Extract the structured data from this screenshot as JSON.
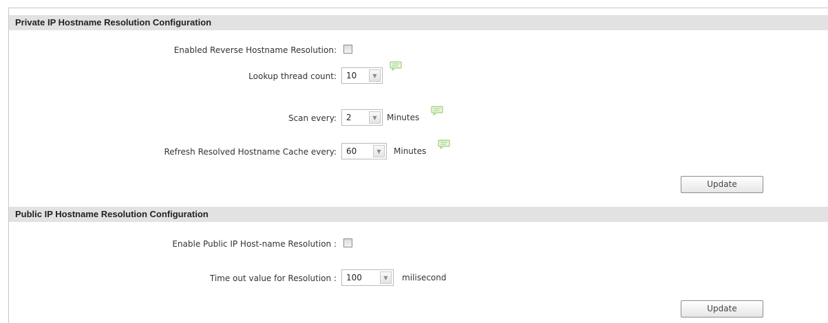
{
  "private": {
    "title": "Private IP Hostname Resolution Configuration",
    "reverse_label": "Enabled Reverse Hostname Resolution:",
    "reverse_checked": false,
    "thread_label": "Lookup thread count:",
    "thread_value": "10",
    "scan_label": "Scan every:",
    "scan_value": "2",
    "scan_unit": "Minutes",
    "refresh_label": "Refresh Resolved Hostname Cache every:",
    "refresh_value": "60",
    "refresh_unit": "Minutes",
    "update_label": "Update"
  },
  "public": {
    "title": "Public IP Hostname Resolution Configuration",
    "enable_label": "Enable Public IP Host-name Resolution :",
    "enable_checked": false,
    "timeout_label": "Time out value for Resolution :",
    "timeout_value": "100",
    "timeout_unit": "milisecond",
    "update_label": "Update"
  },
  "icons": {
    "dropdown": "chevron-down-icon",
    "info": "speech-bubble-icon"
  },
  "colors": {
    "header_bg": "#e2e2e2",
    "info_icon": "#9bd07a",
    "border": "#c8c8c8"
  }
}
